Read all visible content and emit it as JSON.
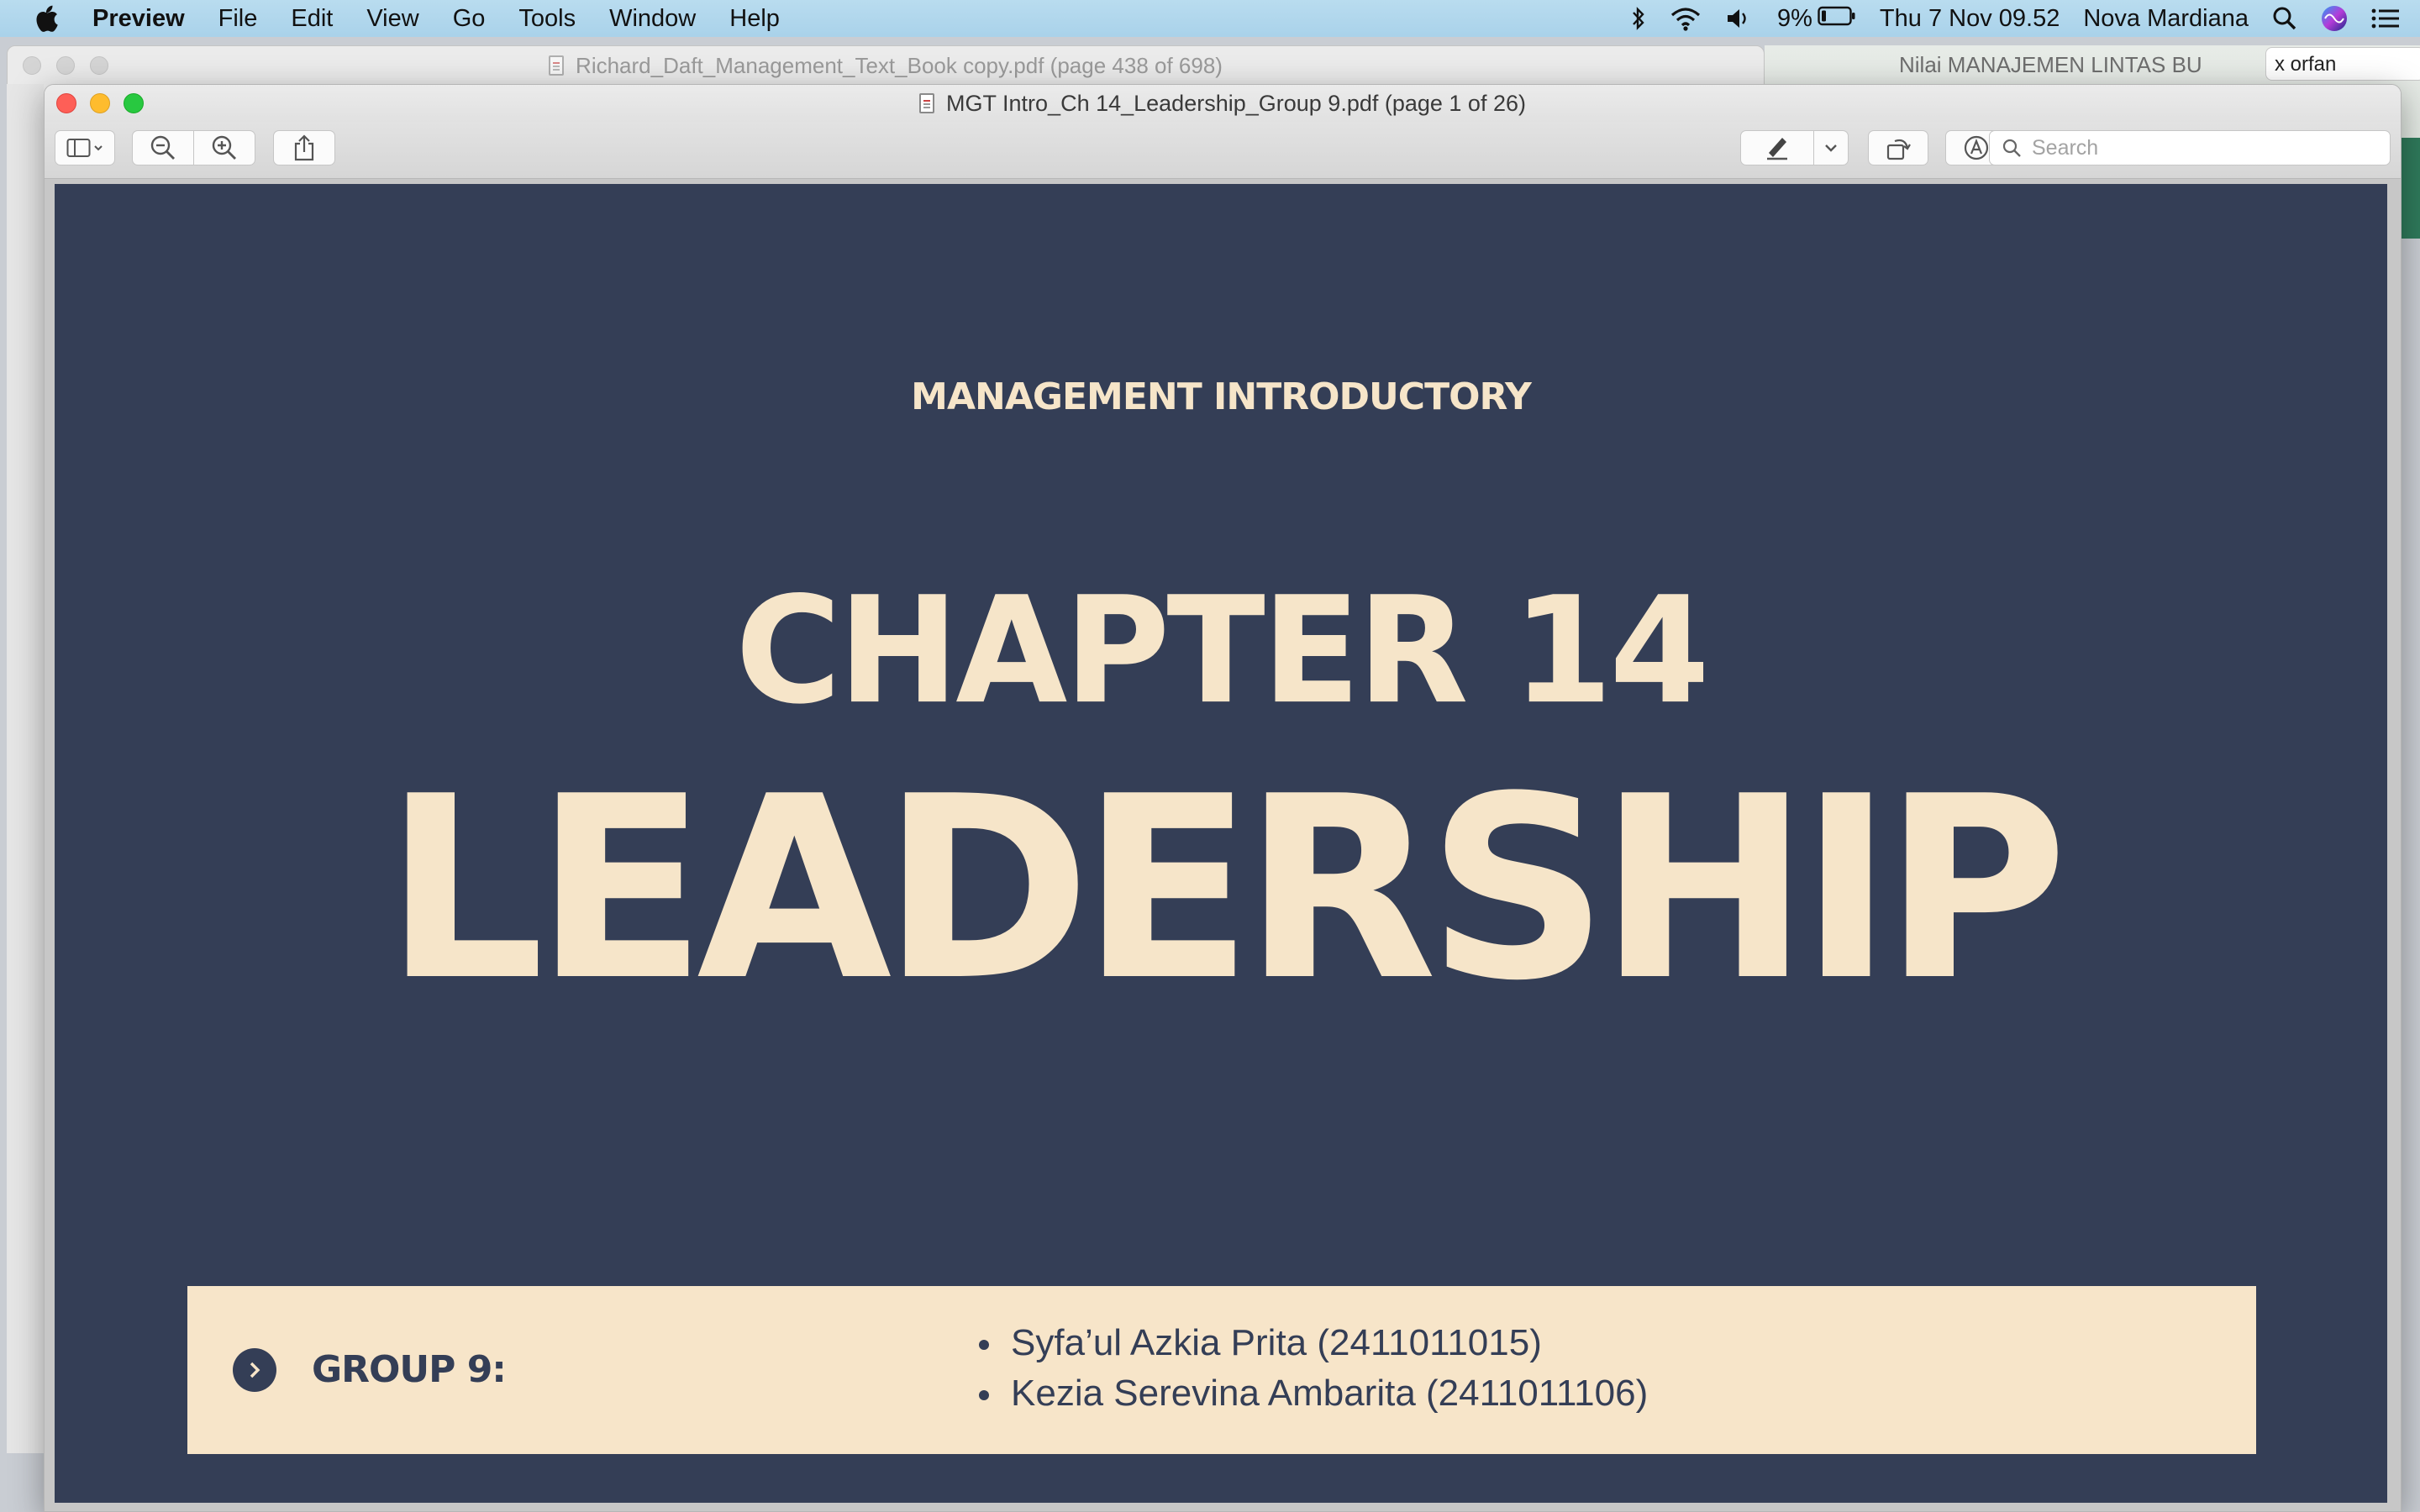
{
  "menubar": {
    "app_name": "Preview",
    "menus": [
      "File",
      "Edit",
      "View",
      "Go",
      "Tools",
      "Window",
      "Help"
    ],
    "battery": "9%",
    "datetime": "Thu 7 Nov  09.52",
    "user": "Nova Mardiana"
  },
  "background_window": {
    "title": "Richard_Daft_Management_Text_Book copy.pdf (page 438 of 698)"
  },
  "other_window": {
    "tab_title": "Nilai MANAJEMEN LINTAS BU",
    "search_value": "x orfan"
  },
  "window": {
    "title": "MGT Intro_Ch 14_Leadership_Group 9.pdf (page 1 of 26)",
    "search_placeholder": "Search"
  },
  "slide": {
    "eyebrow": "MANAGEMENT INTRODUCTORY",
    "chapter": "CHAPTER 14",
    "headline": "LEADERSHIP",
    "group_label": "GROUP 9:",
    "members": [
      "Syfa’ul Azkia Prita (2411011015)",
      "Kezia Serevina Ambarita (2411011106)"
    ]
  },
  "colors": {
    "slide_background": "#343e56",
    "slide_cream": "#f6e5c9"
  }
}
